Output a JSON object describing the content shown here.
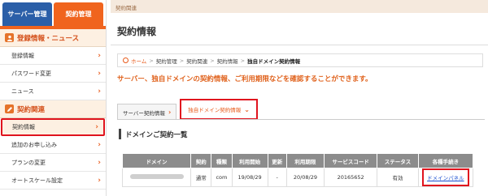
{
  "sidebar": {
    "tabs": [
      {
        "label": "サーバー管理"
      },
      {
        "label": "契約管理"
      }
    ],
    "section1": {
      "title": "登録情報・ニュース",
      "icon": "person-icon"
    },
    "section1_items": [
      {
        "label": "登録情報"
      },
      {
        "label": "パスワード変更"
      },
      {
        "label": "ニュース"
      }
    ],
    "section2": {
      "title": "契約関連",
      "icon": "pencil-icon"
    },
    "section2_items": [
      {
        "label": "契約情報"
      },
      {
        "label": "追加のお申し込み"
      },
      {
        "label": "プランの変更"
      },
      {
        "label": "オートスケール設定"
      }
    ]
  },
  "main": {
    "crumb_top": "契約関連",
    "title": "契約情報",
    "breadcrumb": {
      "home": "ホーム",
      "items": [
        "契約管理",
        "契約関連",
        "契約情報"
      ],
      "current": "独自ドメイン契約情報"
    },
    "notice": "サーバー、独自ドメインの契約情報、ご利用期限などを確認することができます。",
    "tabs": [
      {
        "label": "サーバー契約情報"
      },
      {
        "label": "独自ドメイン契約情報"
      }
    ],
    "list_title": "ドメインご契約一覧",
    "table": {
      "headers": [
        "ドメイン",
        "契約",
        "種類",
        "利用開始",
        "更新",
        "利用期限",
        "サービスコード",
        "ステータス",
        "各種手続き"
      ],
      "rows": [
        [
          "",
          "通常",
          "com",
          "19/08/29",
          "-",
          "20/08/29",
          "20165652",
          "有効",
          "ドメインパネル"
        ]
      ]
    }
  },
  "colors": {
    "accent": "#f0641e",
    "brand_blue": "#2b5fa8",
    "highlight": "#e0141e"
  }
}
